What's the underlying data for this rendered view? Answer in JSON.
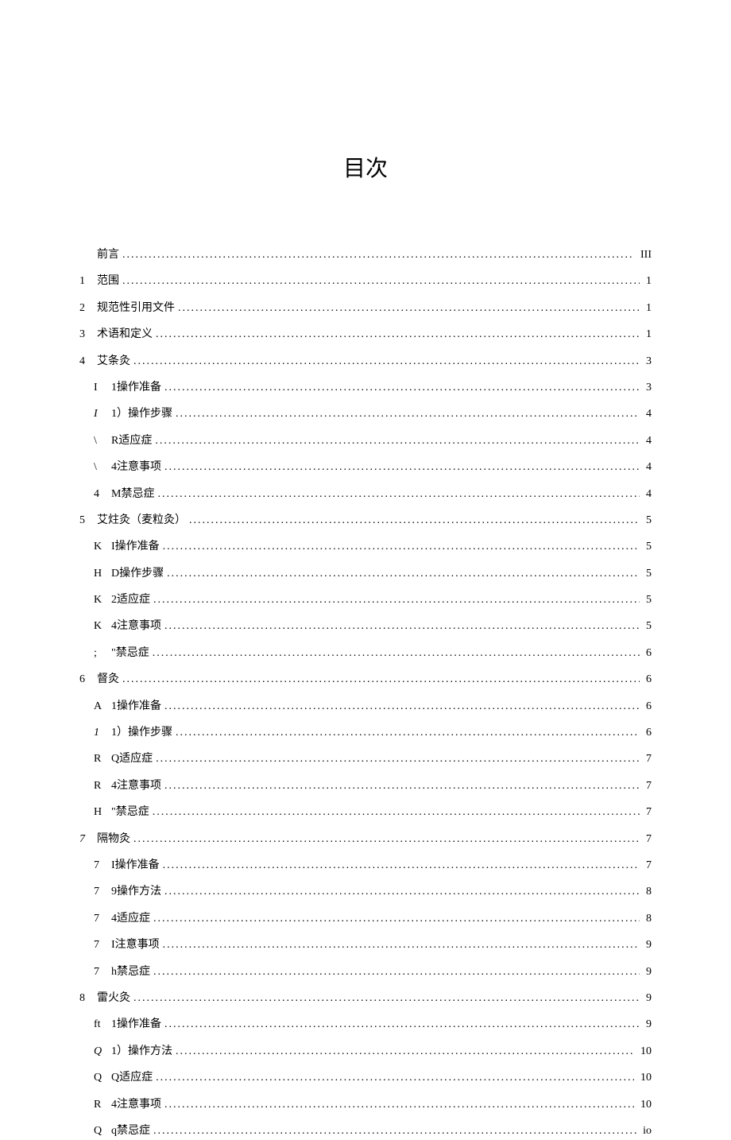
{
  "title": "目次",
  "toc": [
    {
      "level": 1,
      "prefix": "",
      "label": "前言",
      "page": "III"
    },
    {
      "level": 1,
      "prefix": "1",
      "label": "范围",
      "page": "1"
    },
    {
      "level": 1,
      "prefix": "2",
      "label": "规范性引用文件",
      "page": "1"
    },
    {
      "level": 1,
      "prefix": "3",
      "label": "术语和定义",
      "page": "1"
    },
    {
      "level": 1,
      "prefix": "4",
      "label": "艾条灸",
      "page": "3",
      "spacerTop": true
    },
    {
      "level": 2,
      "prefix": "I",
      "label": "1操作准备",
      "page": "3"
    },
    {
      "level": 2,
      "prefix": "I",
      "label": "1）操作步骤",
      "page": "4",
      "prefixItalic": true
    },
    {
      "level": 2,
      "prefix": "\\",
      "label": "R适应症",
      "page": "4"
    },
    {
      "level": 2,
      "prefix": "\\",
      "label": "4注意事项",
      "page": "4"
    },
    {
      "level": 2,
      "prefix": "4",
      "label": "M禁忌症",
      "page": "4"
    },
    {
      "level": 1,
      "prefix": "5",
      "label": "艾炷灸（麦粒灸）",
      "page": "5",
      "spacerTop": true
    },
    {
      "level": 2,
      "prefix": "K",
      "label": "I操作准备",
      "page": "5"
    },
    {
      "level": 2,
      "prefix": "H",
      "label": "D操作步骤",
      "page": "5",
      "labelItalicFirst": true
    },
    {
      "level": 2,
      "prefix": "K",
      "label": "2适应症",
      "page": "5"
    },
    {
      "level": 2,
      "prefix": "K",
      "label": "4注意事项",
      "page": "5"
    },
    {
      "level": 2,
      "prefix": ";",
      "label": "\"禁忌症",
      "page": "6"
    },
    {
      "level": 1,
      "prefix": "6",
      "label": "督灸",
      "page": "6",
      "spacerTop": true
    },
    {
      "level": 2,
      "prefix": "A",
      "label": "1操作准备",
      "page": "6"
    },
    {
      "level": 2,
      "prefix": "1",
      "label": "1）操作步骤",
      "page": "6",
      "prefixItalic": true
    },
    {
      "level": 2,
      "prefix": "R",
      "label": "Q适应症",
      "page": "7"
    },
    {
      "level": 2,
      "prefix": "R",
      "label": "4注意事项",
      "page": "7"
    },
    {
      "level": 2,
      "prefix": "H",
      "label": "\"禁忌症",
      "page": "7"
    },
    {
      "level": 1,
      "prefix": "7",
      "label": "隔物灸",
      "page": "7",
      "spacerTop": true,
      "prefixItalic": true
    },
    {
      "level": 2,
      "prefix": "7",
      "label": "I操作准备",
      "page": "7"
    },
    {
      "level": 2,
      "prefix": "7",
      "label": "9操作方法",
      "page": "8"
    },
    {
      "level": 2,
      "prefix": "7",
      "label": "4适应症",
      "page": "8"
    },
    {
      "level": 2,
      "prefix": "7",
      "label": "I注意事项",
      "page": "9"
    },
    {
      "level": 2,
      "prefix": "7",
      "label": "h禁忌症",
      "page": "9"
    },
    {
      "level": 1,
      "prefix": "8",
      "label": "雷火灸",
      "page": "9",
      "spacerTop": true
    },
    {
      "level": 2,
      "prefix": "ft",
      "label": "1操作准备",
      "page": "9"
    },
    {
      "level": 2,
      "prefix": "Q",
      "label": "1）操作方法",
      "page": "10",
      "prefixItalic": true
    },
    {
      "level": 2,
      "prefix": "Q",
      "label": "Q适应症",
      "page": "10"
    },
    {
      "level": 2,
      "prefix": "R",
      "label": "4注意事项",
      "page": "10"
    },
    {
      "level": 2,
      "prefix": "Q",
      "label": "q禁忌症",
      "page": "io"
    }
  ]
}
